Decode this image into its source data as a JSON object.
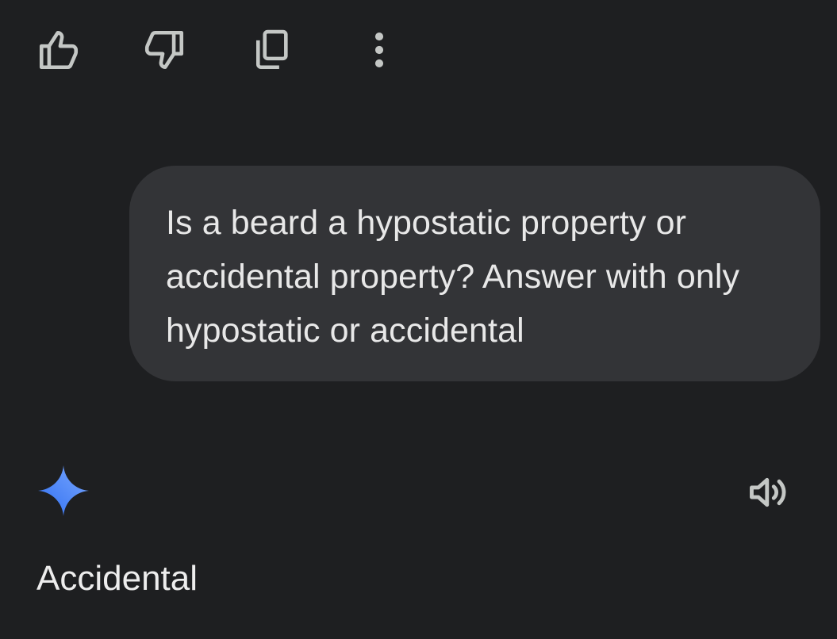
{
  "actions": {
    "like_icon": "thumbs-up-icon",
    "dislike_icon": "thumbs-down-icon",
    "copy_icon": "copy-icon",
    "more_icon": "more-vertical-icon"
  },
  "conversation": {
    "user_message": "Is a beard a hypostatic property or accidental property? Answer with only hypostatic or accidental",
    "model_icon": "gemini-spark-icon",
    "listen_icon": "speaker-icon",
    "model_response": "Accidental"
  },
  "colors": {
    "background": "#1e1f21",
    "bubble": "#333437",
    "icon": "#c4c7c5",
    "spark_gradient_start": "#3b82f6",
    "spark_gradient_end": "#6aa0ff"
  }
}
